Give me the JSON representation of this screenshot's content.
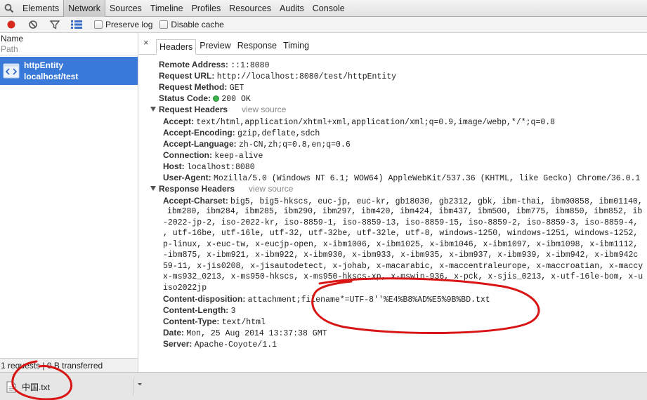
{
  "tabs": [
    "Elements",
    "Network",
    "Sources",
    "Timeline",
    "Profiles",
    "Resources",
    "Audits",
    "Console"
  ],
  "toolbar": {
    "preserve_log": "Preserve log",
    "disable_cache": "Disable cache"
  },
  "left": {
    "col_name": "Name",
    "col_path": "Path",
    "request": {
      "name": "httpEntity",
      "path": "localhost/test"
    },
    "status": "1 requests | 0 B transferred"
  },
  "subtabs": {
    "close": "×",
    "items": [
      "Headers",
      "Preview",
      "Response",
      "Timing"
    ]
  },
  "general": [
    {
      "label": "Remote Address:",
      "value": "::1:8080"
    },
    {
      "label": "Request URL:",
      "value": "http://localhost:8080/test/httpEntity"
    },
    {
      "label": "Request Method:",
      "value": "GET"
    },
    {
      "label": "Status Code:",
      "value": "200 OK"
    }
  ],
  "request_headers": {
    "title": "Request Headers",
    "view_source": "view source",
    "items": [
      {
        "label": "Accept:",
        "value": "text/html,application/xhtml+xml,application/xml;q=0.9,image/webp,*/*;q=0.8"
      },
      {
        "label": "Accept-Encoding:",
        "value": "gzip,deflate,sdch"
      },
      {
        "label": "Accept-Language:",
        "value": "zh-CN,zh;q=0.8,en;q=0.6"
      },
      {
        "label": "Connection:",
        "value": "keep-alive"
      },
      {
        "label": "Host:",
        "value": "localhost:8080"
      },
      {
        "label": "User-Agent:",
        "value": "Mozilla/5.0 (Windows NT 6.1; WOW64) AppleWebKit/537.36 (KHTML, like Gecko) Chrome/36.0.1"
      }
    ]
  },
  "response_headers": {
    "title": "Response Headers",
    "view_source": "view source",
    "accept_charset_label": "Accept-Charset:",
    "accept_charset_lines": [
      "big5, big5-hkscs, euc-jp, euc-kr, gb18030, gb2312, gbk, ibm-thai, ibm00858, ibm01140,",
      "ibm280, ibm284, ibm285, ibm290, ibm297, ibm420, ibm424, ibm437, ibm500, ibm775, ibm850, ibm852, ib",
      "-2022-jp-2, iso-2022-kr, iso-8859-1, iso-8859-13, iso-8859-15, iso-8859-2, iso-8859-3, iso-8859-4,",
      ", utf-16be, utf-16le, utf-32, utf-32be, utf-32le, utf-8, windows-1250, windows-1251, windows-1252,",
      "p-linux, x-euc-tw, x-eucjp-open, x-ibm1006, x-ibm1025, x-ibm1046, x-ibm1097, x-ibm1098, x-ibm1112,",
      "-ibm875, x-ibm921, x-ibm922, x-ibm930, x-ibm933, x-ibm935, x-ibm937, x-ibm939, x-ibm942, x-ibm942c",
      "59-11, x-jis0208, x-jisautodetect, x-johab, x-macarabic, x-maccentraleurope, x-maccroatian, x-maccy",
      "x-ms932_0213, x-ms950-hkscs, x-ms950-hkscs-xp, x-mswin-936, x-pck, x-sjis_0213, x-utf-16le-bom, x-u",
      "iso2022jp"
    ],
    "items": [
      {
        "label": "Content-disposition:",
        "value": "attachment;filename*=UTF-8''%E4%B8%AD%E5%9B%BD.txt"
      },
      {
        "label": "Content-Length:",
        "value": "3"
      },
      {
        "label": "Content-Type:",
        "value": "text/html"
      },
      {
        "label": "Date:",
        "value": "Mon, 25 Aug 2014 13:37:38 GMT"
      },
      {
        "label": "Server:",
        "value": "Apache-Coyote/1.1"
      }
    ]
  },
  "download": {
    "filename": "中国.txt"
  },
  "colors": {
    "selected_row": "#3879d9",
    "record_red": "#d62a1e",
    "annotation_red": "#d81414",
    "status_green": "#39b54a"
  },
  "icons": [
    "search-icon",
    "record-icon",
    "clear-icon",
    "filter-icon",
    "list-view-icon",
    "document-icon",
    "file-icon",
    "chevron-down-icon",
    "close-icon"
  ]
}
